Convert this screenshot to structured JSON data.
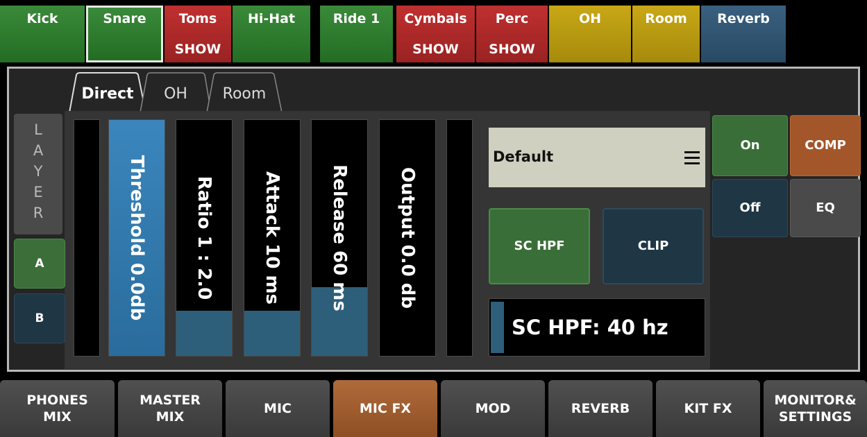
{
  "channels": [
    {
      "label": "Kick",
      "sub": "",
      "color": "green"
    },
    {
      "label": "Snare",
      "sub": "",
      "color": "green",
      "selected": true
    },
    {
      "label": "Toms",
      "sub": "SHOW",
      "color": "red"
    },
    {
      "label": "Hi-Hat",
      "sub": "",
      "color": "green"
    },
    {
      "label": "Ride 1",
      "sub": "",
      "color": "green"
    },
    {
      "label": "Cymbals",
      "sub": "SHOW",
      "color": "red"
    },
    {
      "label": "Perc",
      "sub": "SHOW",
      "color": "red"
    },
    {
      "label": "OH",
      "sub": "",
      "color": "yellow"
    },
    {
      "label": "Room",
      "sub": "",
      "color": "yellow"
    },
    {
      "label": "Reverb",
      "sub": "",
      "color": "blue"
    }
  ],
  "tabs": [
    "Direct",
    "OH",
    "Room"
  ],
  "layer": {
    "title": [
      "L",
      "A",
      "Y",
      "E",
      "R"
    ],
    "a": "A",
    "b": "B"
  },
  "sliders": [
    {
      "label": "Threshold 0.0db",
      "level": 1.0
    },
    {
      "label": "Ratio 1 : 2.0",
      "level": 0.19
    },
    {
      "label": "Attack 10 ms",
      "level": 0.19
    },
    {
      "label": "Release 60 ms",
      "level": 0.29
    },
    {
      "label": "Output 0.0 db",
      "level": 0.0
    }
  ],
  "preset": {
    "name": "Default"
  },
  "buttons": {
    "sc_hpf": "SC HPF",
    "clip": "CLIP",
    "on": "On",
    "off": "Off",
    "comp": "COMP",
    "eq": "EQ"
  },
  "hpf_display": {
    "text": "SC HPF: 40 hz",
    "level": 0.06
  },
  "nav": [
    {
      "label": "PHONES\nMIX"
    },
    {
      "label": "MASTER\nMIX"
    },
    {
      "label": "MIC"
    },
    {
      "label": "MIC FX",
      "active": true
    },
    {
      "label": "MOD"
    },
    {
      "label": "REVERB"
    },
    {
      "label": "KIT FX"
    },
    {
      "label": "MONITOR&\nSETTINGS"
    }
  ],
  "colors": {
    "green": "#2d7a2d",
    "red": "#b02a2a",
    "yellow": "#b89a10",
    "blue": "#2f5470",
    "accent": "#a2562a"
  }
}
